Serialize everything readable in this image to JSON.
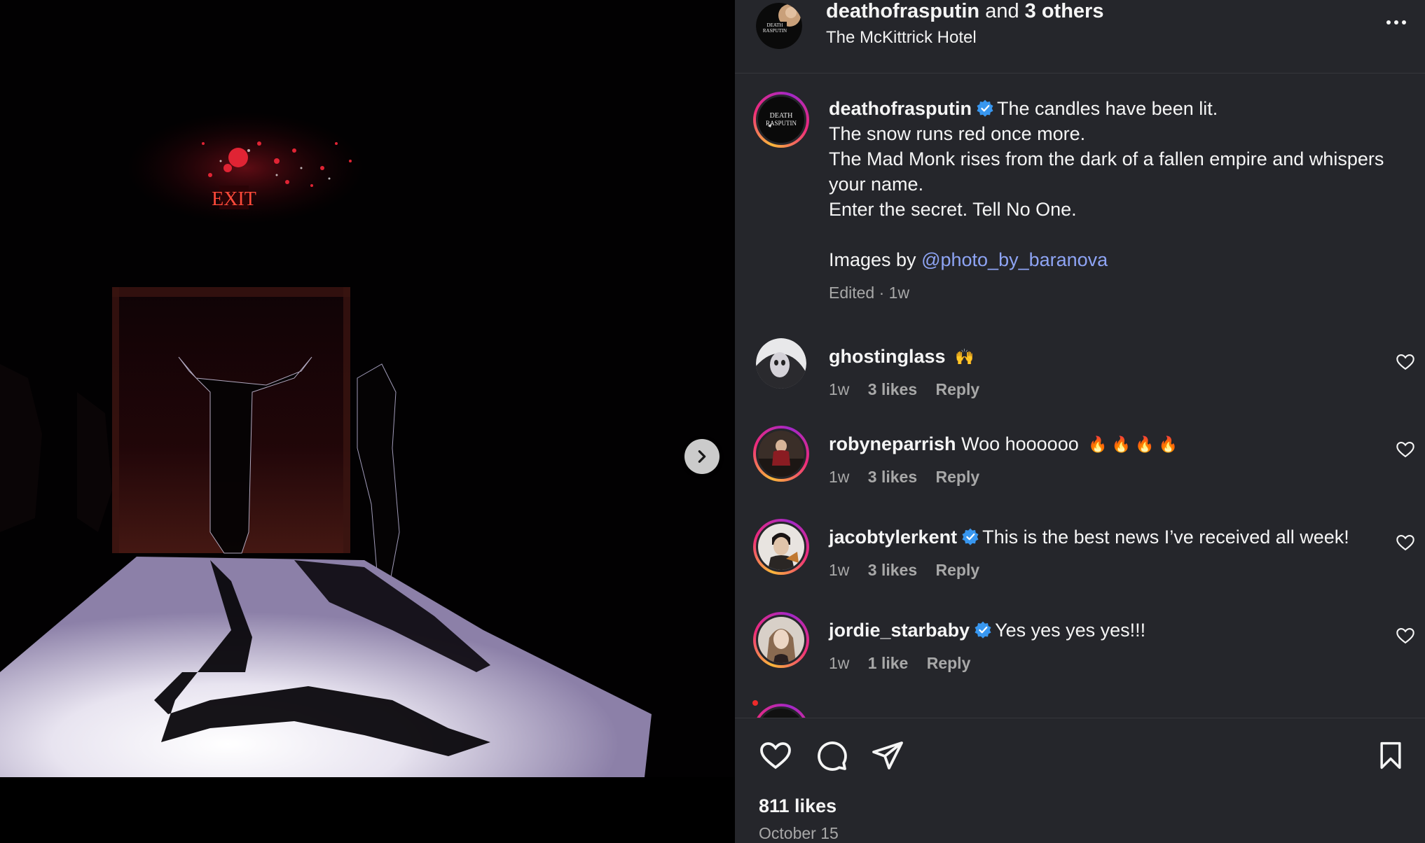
{
  "header": {
    "username": "deathofrasputin",
    "and_text": "and",
    "others": "3 others",
    "location": "The McKittrick Hotel"
  },
  "media": {
    "exit_sign": "EXIT"
  },
  "caption": {
    "username": "deathofrasputin",
    "line1": "The candles have been lit.",
    "line2": "The snow runs red once more.",
    "line3": "The Mad Monk rises from the dark of a fallen empire and whispers your name.",
    "line4": "Enter the secret. Tell No One.",
    "credit_prefix": "Images by",
    "credit_mention": "@photo_by_baranova",
    "meta": "Edited · 1w"
  },
  "comments": [
    {
      "username": "ghostinglass",
      "text": "",
      "emoji": "🙌",
      "verified": false,
      "time": "1w",
      "likes": "3 likes",
      "reply": "Reply"
    },
    {
      "username": "robyneparrish",
      "text": "Woo hoooooo",
      "emoji": "🔥 🔥 🔥 🔥",
      "verified": false,
      "time": "1w",
      "likes": "3 likes",
      "reply": "Reply"
    },
    {
      "username": "jacobtylerkent",
      "text": "This is the best news I’ve received all week!",
      "emoji": "",
      "verified": true,
      "time": "1w",
      "likes": "3 likes",
      "reply": "Reply"
    },
    {
      "username": "jordie_starbaby",
      "text": "Yes yes yes yes!!!",
      "emoji": "",
      "verified": true,
      "time": "1w",
      "likes": "1 like",
      "reply": "Reply"
    }
  ],
  "footer": {
    "likes": "811 likes",
    "date": "October 15"
  },
  "colors": {
    "panel_bg": "#25262b",
    "verified_blue": "#3897f0",
    "mention": "#8ea4f4",
    "muted": "#a8a8a8"
  },
  "icons": {
    "more": "more-horizontal-icon",
    "like": "heart-icon",
    "comment": "comment-bubble-icon",
    "share": "paper-plane-icon",
    "save": "bookmark-icon",
    "next": "chevron-right-icon",
    "verified": "verified-badge-icon"
  }
}
